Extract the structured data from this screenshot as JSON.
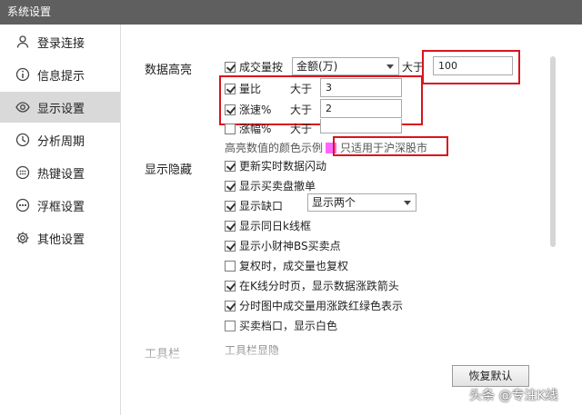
{
  "window": {
    "title": "系统设置"
  },
  "sidebar": {
    "items": [
      {
        "label": "登录连接",
        "icon": "user-icon"
      },
      {
        "label": "信息提示",
        "icon": "info-icon"
      },
      {
        "label": "显示设置",
        "icon": "eye-icon"
      },
      {
        "label": "分析周期",
        "icon": "clock-icon"
      },
      {
        "label": "热键设置",
        "icon": "keyboard-icon"
      },
      {
        "label": "浮框设置",
        "icon": "dots-icon"
      },
      {
        "label": "其他设置",
        "icon": "gear-icon"
      }
    ],
    "active_index": 2
  },
  "highlight": {
    "section_label": "数据高亮",
    "volume": {
      "label": "成交量按",
      "checked": true,
      "select_value": "金额(万)",
      "gt_label": "大于",
      "value": "100"
    },
    "ratio": {
      "label": "量比",
      "checked": true,
      "gt_label": "大于",
      "value": "3"
    },
    "speed": {
      "label": "涨速%",
      "checked": true,
      "gt_label": "大于",
      "value": "2"
    },
    "change": {
      "label": "涨幅%",
      "checked": false,
      "gt_label": "大于"
    },
    "color_example_label": "高亮数值的颜色示例",
    "color_example_color": "#ff66ff",
    "note": "只适用于沪深股市"
  },
  "display": {
    "section_label": "显示隐藏",
    "items": [
      {
        "label": "更新实时数据闪动",
        "checked": true
      },
      {
        "label": "显示买卖盘撤单",
        "checked": true
      },
      {
        "label": "显示缺口",
        "checked": true,
        "select_value": "显示两个"
      },
      {
        "label": "显示同日k线框",
        "checked": true
      },
      {
        "label": "显示小财神BS买卖点",
        "checked": true
      },
      {
        "label": "复权时，成交量也复权",
        "checked": false
      },
      {
        "label": "在K线分时页，显示数据涨跌箭头",
        "checked": true
      },
      {
        "label": "分时图中成交量用涨跌红绿色表示",
        "checked": true
      },
      {
        "label": "买卖档口，显示白色",
        "checked": false
      }
    ]
  },
  "toolbar": {
    "section_label": "工具栏",
    "sub_label": "工具栏显隐"
  },
  "buttons": {
    "restore_default": "恢复默认"
  },
  "watermark": "头条 @专注K线",
  "colors": {
    "annotation_red": "#d9141d",
    "titlebar": "#5f5f5f",
    "active_item": "#d9d9d9"
  }
}
